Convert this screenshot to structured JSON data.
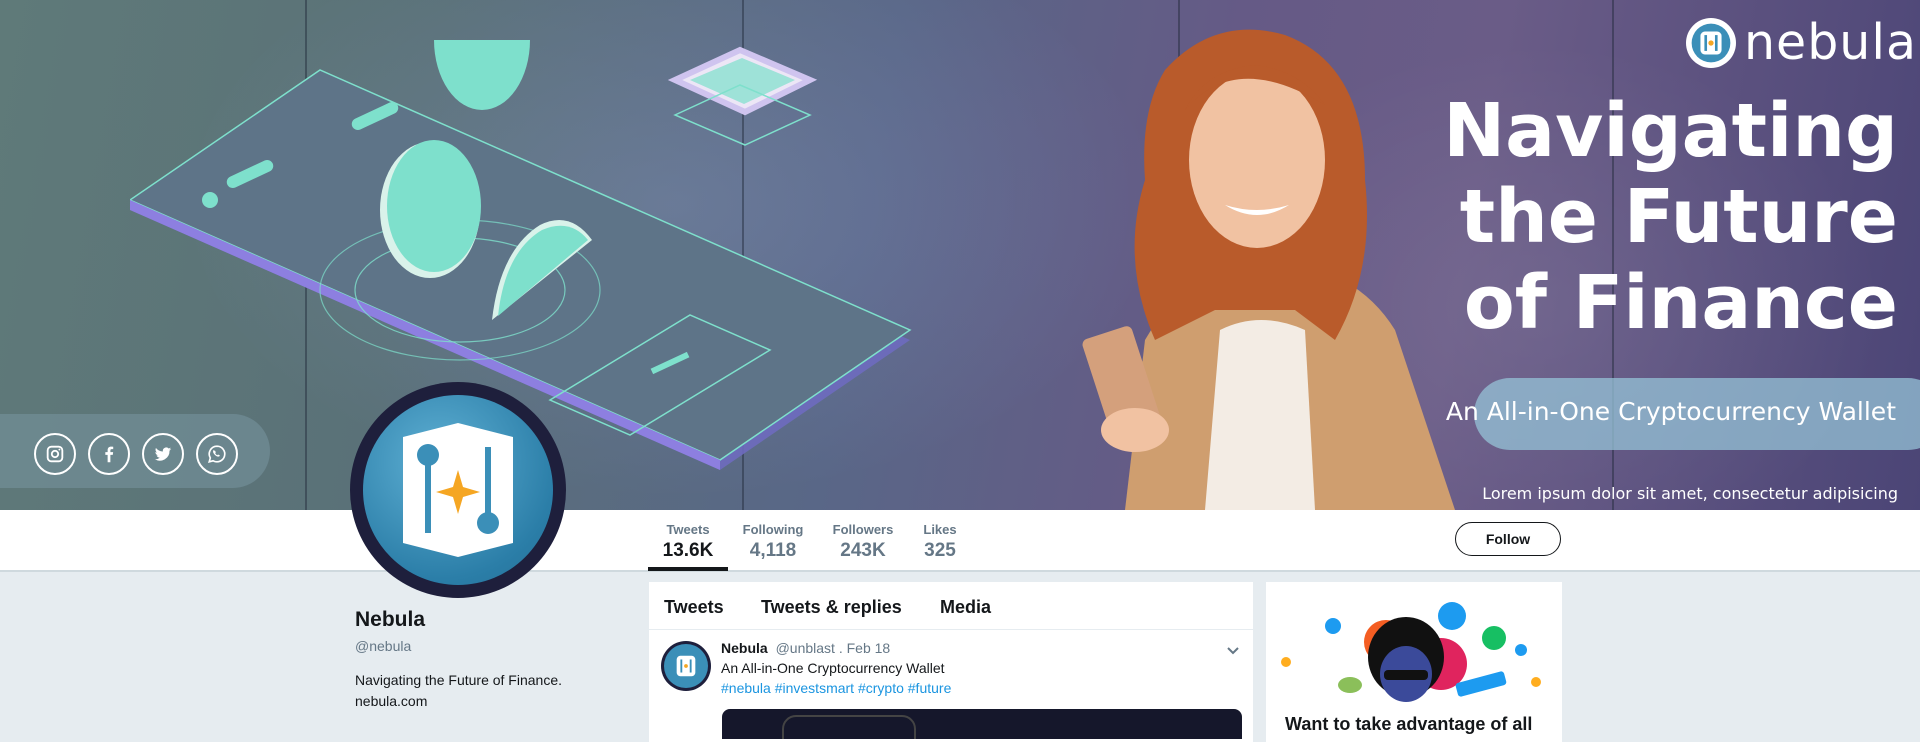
{
  "brand": {
    "name": "nebula"
  },
  "banner": {
    "headline": [
      "Navigating",
      "the Future",
      "of Finance"
    ],
    "tagline": "An All-in-One Cryptocurrency Wallet",
    "lorem": "Lorem ipsum dolor sit amet, consectetur adipisicing"
  },
  "social_icons": [
    "instagram-icon",
    "facebook-icon",
    "twitter-icon",
    "whatsapp-icon"
  ],
  "stats": [
    {
      "label": "Tweets",
      "value": "13.6K"
    },
    {
      "label": "Following",
      "value": "4,118"
    },
    {
      "label": "Followers",
      "value": "243K"
    },
    {
      "label": "Likes",
      "value": "325"
    }
  ],
  "follow_label": "Follow",
  "profile": {
    "name": "Nebula",
    "handle": "@nebula",
    "bio": "Navigating the Future of Finance.",
    "url": "nebula.com"
  },
  "timeline": {
    "tabs": [
      "Tweets",
      "Tweets & replies",
      "Media"
    ],
    "tweet": {
      "name": "Nebula",
      "meta": "@unblast . Feb 18",
      "text": "An All-in-One Cryptocurrency Wallet",
      "hashtags": "#nebula #investsmart #crypto #future"
    }
  },
  "side_card": {
    "text": "Want to take advantage of all"
  },
  "colors": {
    "accent": "#1b95e0",
    "brand_blue": "#3b8fb8",
    "mint": "#7ee0cc"
  }
}
